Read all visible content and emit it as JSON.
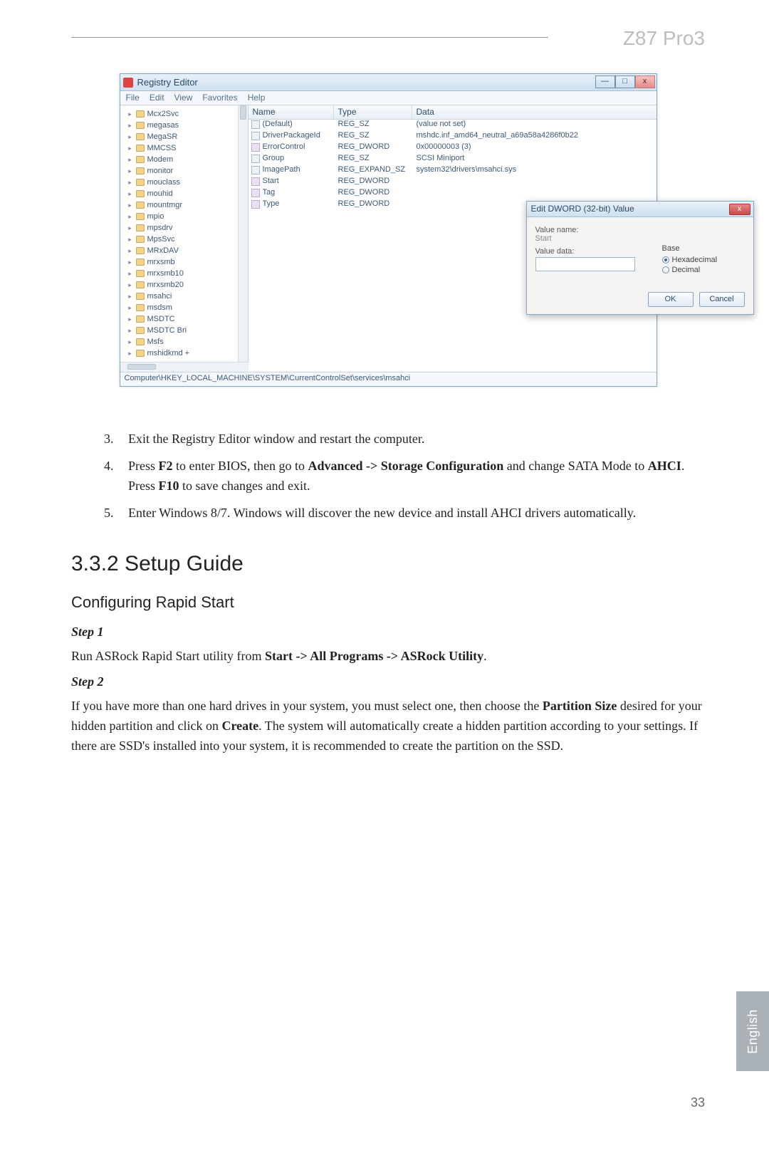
{
  "header": {
    "product": "Z87 Pro3"
  },
  "regedit": {
    "title": "Registry Editor",
    "menus": [
      "File",
      "Edit",
      "View",
      "Favorites",
      "Help"
    ],
    "tree": [
      "Mcx2Svc",
      "megasas",
      "MegaSR",
      "MMCSS",
      "Modem",
      "monitor",
      "mouclass",
      "mouhid",
      "mountmgr",
      "mpio",
      "mpsdrv",
      "MpsSvc",
      "MRxDAV",
      "mrxsmb",
      "mrxsmb10",
      "mrxsmb20",
      "msahci",
      "msdsm",
      "MSDTC",
      "MSDTC Bri",
      "Msfs",
      "mshidkmd +"
    ],
    "columns": {
      "name": "Name",
      "type": "Type",
      "data": "Data"
    },
    "rows": [
      {
        "icon": "sz",
        "name": "(Default)",
        "type": "REG_SZ",
        "data": "(value not set)"
      },
      {
        "icon": "sz",
        "name": "DriverPackageId",
        "type": "REG_SZ",
        "data": "mshdc.inf_amd64_neutral_a69a58a4286f0b22"
      },
      {
        "icon": "dw",
        "name": "ErrorControl",
        "type": "REG_DWORD",
        "data": "0x00000003 (3)"
      },
      {
        "icon": "sz",
        "name": "Group",
        "type": "REG_SZ",
        "data": "SCSI Miniport"
      },
      {
        "icon": "sz",
        "name": "ImagePath",
        "type": "REG_EXPAND_SZ",
        "data": "system32\\drivers\\msahci.sys"
      },
      {
        "icon": "dw",
        "name": "Start",
        "type": "REG_DWORD",
        "data": ""
      },
      {
        "icon": "dw",
        "name": "Tag",
        "type": "REG_DWORD",
        "data": ""
      },
      {
        "icon": "dw",
        "name": "Type",
        "type": "REG_DWORD",
        "data": ""
      }
    ],
    "status": "Computer\\HKEY_LOCAL_MACHINE\\SYSTEM\\CurrentControlSet\\services\\msahci",
    "dialog": {
      "title": "Edit DWORD (32-bit) Value",
      "valueNameLabel": "Value name:",
      "valueName": "Start",
      "valueDataLabel": "Value data:",
      "baseLabel": "Base",
      "hex": "Hexadecimal",
      "dec": "Decimal",
      "ok": "OK",
      "cancel": "Cancel"
    }
  },
  "steps_list": {
    "s3": "Exit the Registry Editor window and restart the computer.",
    "s4_a": "Press ",
    "s4_b": "F2",
    "s4_c": " to enter BIOS, then go to ",
    "s4_d": "Advanced -> Storage Configuration",
    "s4_e": " and change SATA Mode to ",
    "s4_f": "AHCI",
    "s4_g": ". Press ",
    "s4_h": "F10",
    "s4_i": " to save changes and exit.",
    "s5": "Enter Windows 8/7. Windows will discover the new device and install AHCI drivers automatically."
  },
  "section": {
    "num_title": "3.3.2  Setup Guide",
    "sub": "Configuring Rapid Start"
  },
  "step1": {
    "label": "Step 1",
    "a": "Run ASRock Rapid Start utility from ",
    "b": "Start -> All Programs -> ASRock Utility",
    "c": "."
  },
  "step2": {
    "label": "Step 2",
    "a": "If you have more than one hard drives in your system, you must select one, then choose the ",
    "b": "Partition Size",
    "c": " desired for your hidden partition and click on ",
    "d": "Create",
    "e": ". The system will automatically create a hidden partition according to your settings. If there are SSD's installed into your system, it is recommended to create the partition on the SSD."
  },
  "side_tab": "English",
  "page_number": "33"
}
